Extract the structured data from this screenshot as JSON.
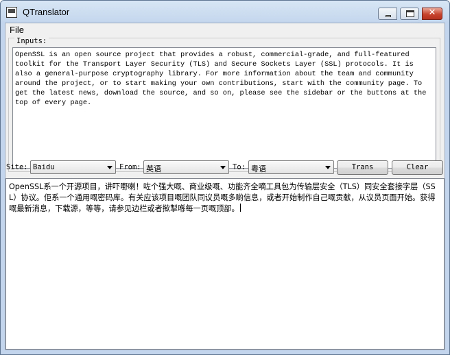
{
  "window": {
    "title": "QTranslator",
    "controls": {
      "minimize": "",
      "maximize": "",
      "close": "✕"
    }
  },
  "menubar": {
    "file": "File"
  },
  "inputs": {
    "group_title": "Inputs:",
    "text": "OpenSSL is an open source project that provides a robust, commercial-grade, and full-featured toolkit for the Transport Layer Security (TLS) and Secure Sockets Layer (SSL) protocols. It is also a general-purpose cryptography library. For more information about the team and community around the project, or to start making your own contributions, start with the community page. To get the latest news, download the source, and so on, please see the sidebar or the buttons at the top of every page."
  },
  "controls_bar": {
    "site_label": "Site:",
    "site_value": "Baidu",
    "from_label": "From:",
    "from_value": "英语",
    "to_label": "To:",
    "to_value": "粤语",
    "trans_button": "Trans",
    "clear_button": "Clear"
  },
  "output": {
    "text": "OpenSSL系一个开源项目，讲吓嘢喇！咗个强大嘅、商业级嘅、功能齐全嘀工具包为传输层安全（TLS）同安全套接字层（SSL）协议。佢系一个通用嘅密码库。有关应该项目嘅团队同议员嘅多啲信息，或者开始制作自己嘅贡献，从议员页面开始。获得嘅最新消息，下载源，等等，请参见边栏或者揿掣喺每一页嘅顶部。"
  }
}
